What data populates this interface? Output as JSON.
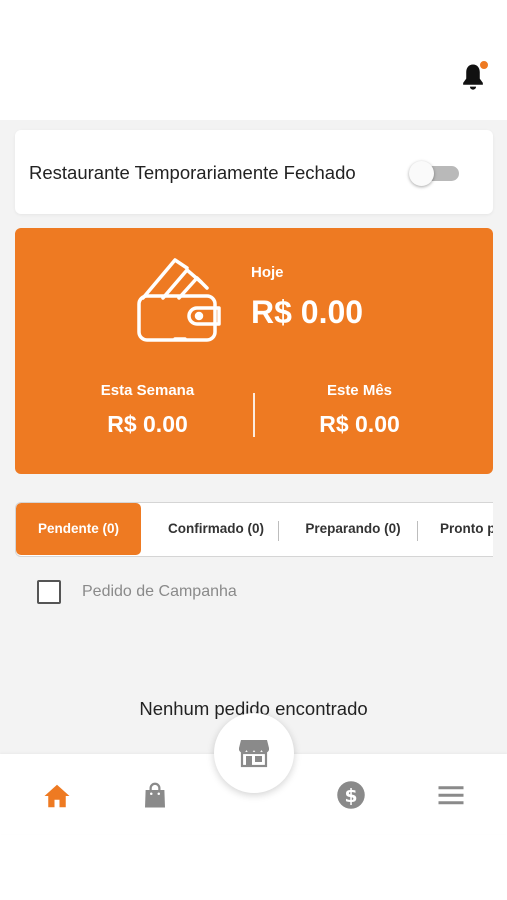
{
  "header": {
    "notification_icon": "bell-icon",
    "notification_badge_color": "#ee7a22"
  },
  "restaurant_status": {
    "label": "Restaurante Temporariamente Fechado",
    "toggle_on": false
  },
  "earnings": {
    "accent_color": "#ee7a22",
    "icon": "wallet-icon",
    "today_label": "Hoje",
    "today_value": "R$ 0.00",
    "week_label": "Esta Semana",
    "week_value": "R$ 0.00",
    "month_label": "Este Mês",
    "month_value": "R$ 0.00"
  },
  "order_tabs": [
    {
      "label": "Pendente (0)",
      "active": true
    },
    {
      "label": "Confirmado (0)",
      "active": false
    },
    {
      "label": "Preparando (0)",
      "active": false
    },
    {
      "label": "Pronto p",
      "active": false
    }
  ],
  "campaign_filter": {
    "label": "Pedido de Campanha",
    "checked": false
  },
  "empty_state": {
    "message": "Nenhum pedido encontrado"
  },
  "bottom_nav": {
    "items": [
      {
        "icon": "home-icon",
        "active": true
      },
      {
        "icon": "shopping-bag-icon",
        "active": false
      },
      {
        "icon": "storefront-icon",
        "active": false
      },
      {
        "icon": "dollar-circle-icon",
        "active": false
      },
      {
        "icon": "menu-icon",
        "active": false
      }
    ],
    "active_color": "#ee7a22",
    "inactive_color": "#9a9a9a"
  }
}
